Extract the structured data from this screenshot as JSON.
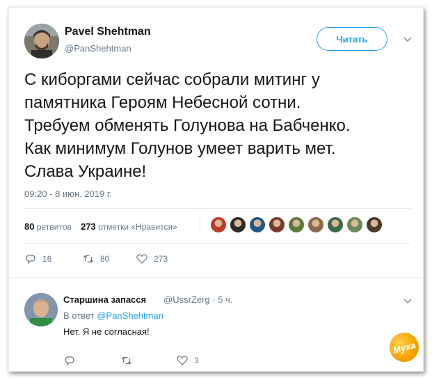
{
  "tweet": {
    "author_name": "Pavel Shehtman",
    "author_handle": "@PanShehtman",
    "follow_label": "Читать",
    "text_lines": [
      "С киборгами сейчас собрали митинг у",
      "памятника Героям Небесной сотни.",
      "Требуем обменять Голунова на Бабченко.",
      "Как минимум Голунов умеет варить мет.",
      "Слава Украине!"
    ],
    "timestamp": "09:20 - 8 июн. 2019 г.",
    "retweets_count": "80",
    "retweets_label": "ретвитов",
    "likes_count": "273",
    "likes_label": "отметки «Нравится»",
    "likers_colors": [
      "#c0392b",
      "#2c2c2c",
      "#1f5a8a",
      "#7a3a2a",
      "#5a7a3a",
      "#8a6a4a",
      "#3a6a4a",
      "#6a8a5a",
      "#4a3a2a"
    ],
    "actions": {
      "reply_count": "16",
      "retweet_count": "80",
      "like_count": "273"
    }
  },
  "reply": {
    "author_name": "Старшина запасся",
    "author_handle": "@UssrZerg · 5 ч.",
    "reply_to_prefix": "В ответ",
    "reply_to_handle": "@PanShehtman",
    "text": "Нет. Я не согласная!",
    "actions": {
      "reply_count": "",
      "retweet_count": "",
      "like_count": "3"
    }
  },
  "watermark_text": "Муха"
}
